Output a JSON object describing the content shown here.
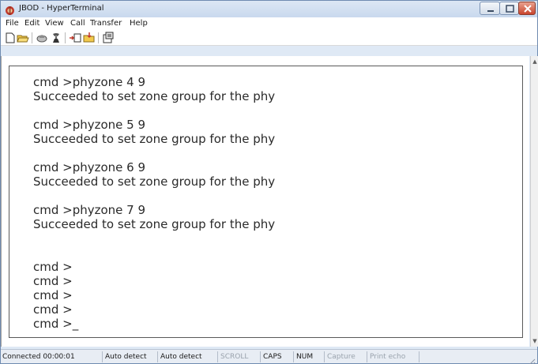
{
  "window": {
    "title": "JBOD - HyperTerminal",
    "app_icon": "hyperterminal-icon",
    "controls": [
      "minimize-icon",
      "maximize-icon",
      "close-icon"
    ]
  },
  "menu": {
    "items": [
      {
        "label": "File"
      },
      {
        "label": "Edit"
      },
      {
        "label": "View"
      },
      {
        "label": "Call"
      },
      {
        "label": "Transfer"
      },
      {
        "label": "Help"
      }
    ]
  },
  "toolbar": {
    "buttons": [
      "new-connection-icon",
      "open-icon",
      "connect-icon",
      "disconnect-icon",
      "send-icon",
      "receive-icon",
      "properties-icon"
    ]
  },
  "terminal": {
    "lines": [
      "cmd >phyzone 4 9",
      "Succeeded to set zone group for the phy",
      "",
      "cmd >phyzone 5 9",
      "Succeeded to set zone group for the phy",
      "",
      "cmd >phyzone 6 9",
      "Succeeded to set zone group for the phy",
      "",
      "cmd >phyzone 7 9",
      "Succeeded to set zone group for the phy",
      "",
      "",
      "cmd >",
      "cmd >",
      "cmd >",
      "cmd >",
      "cmd >_"
    ]
  },
  "statusbar": {
    "connected": "Connected 00:00:01",
    "detect1": "Auto detect",
    "detect2": "Auto detect",
    "scroll": "SCROLL",
    "caps": "CAPS",
    "num": "NUM",
    "capture": "Capture",
    "print_echo": "Print echo"
  }
}
